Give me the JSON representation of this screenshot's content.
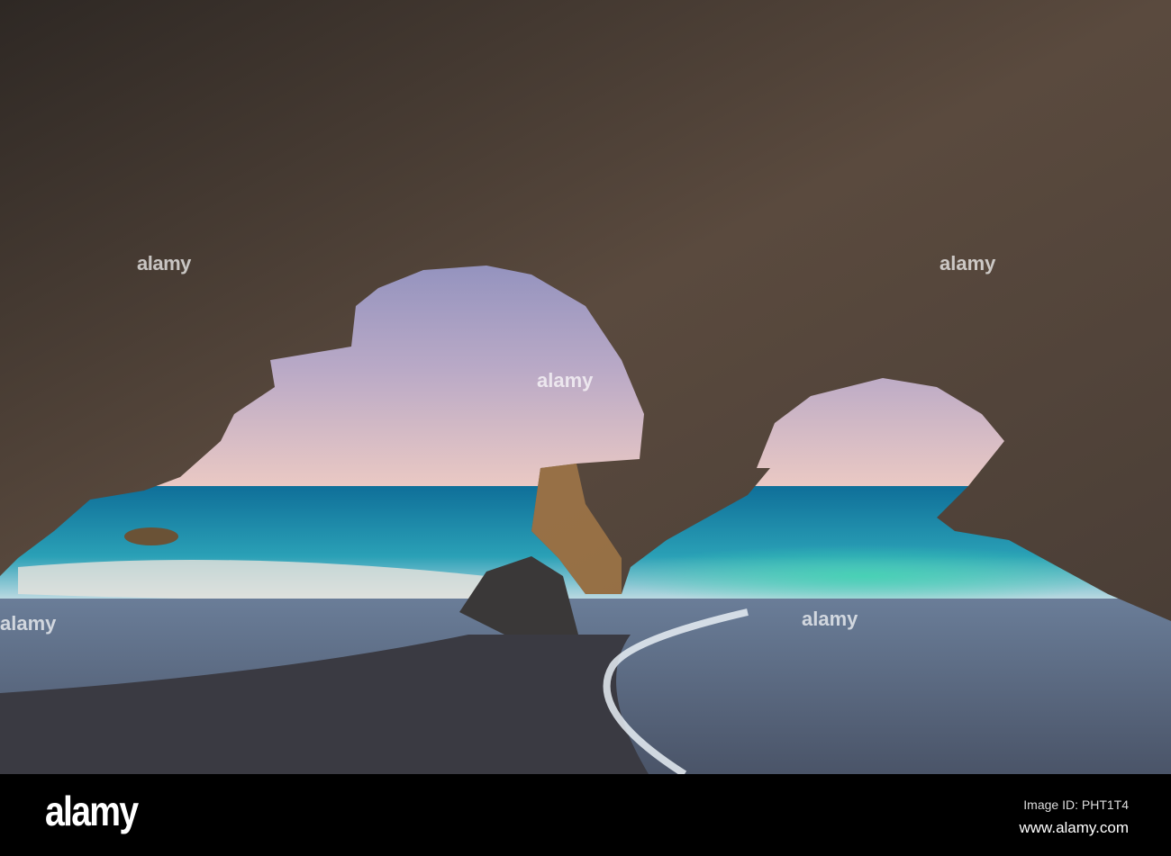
{
  "photo": {
    "subject": "Sea cave arches framing ocean and beach",
    "watermark_text": "alamy",
    "colors": {
      "sky_top": "#6f7fb8",
      "sky_horizon": "#e8c6c4",
      "sea": "#1a8fb0",
      "sand": "#3c3c44",
      "rock": "#4a3f36"
    }
  },
  "footer": {
    "logo": "alamy",
    "image_id": "Image ID: PHT1T4",
    "website": "www.alamy.com"
  }
}
